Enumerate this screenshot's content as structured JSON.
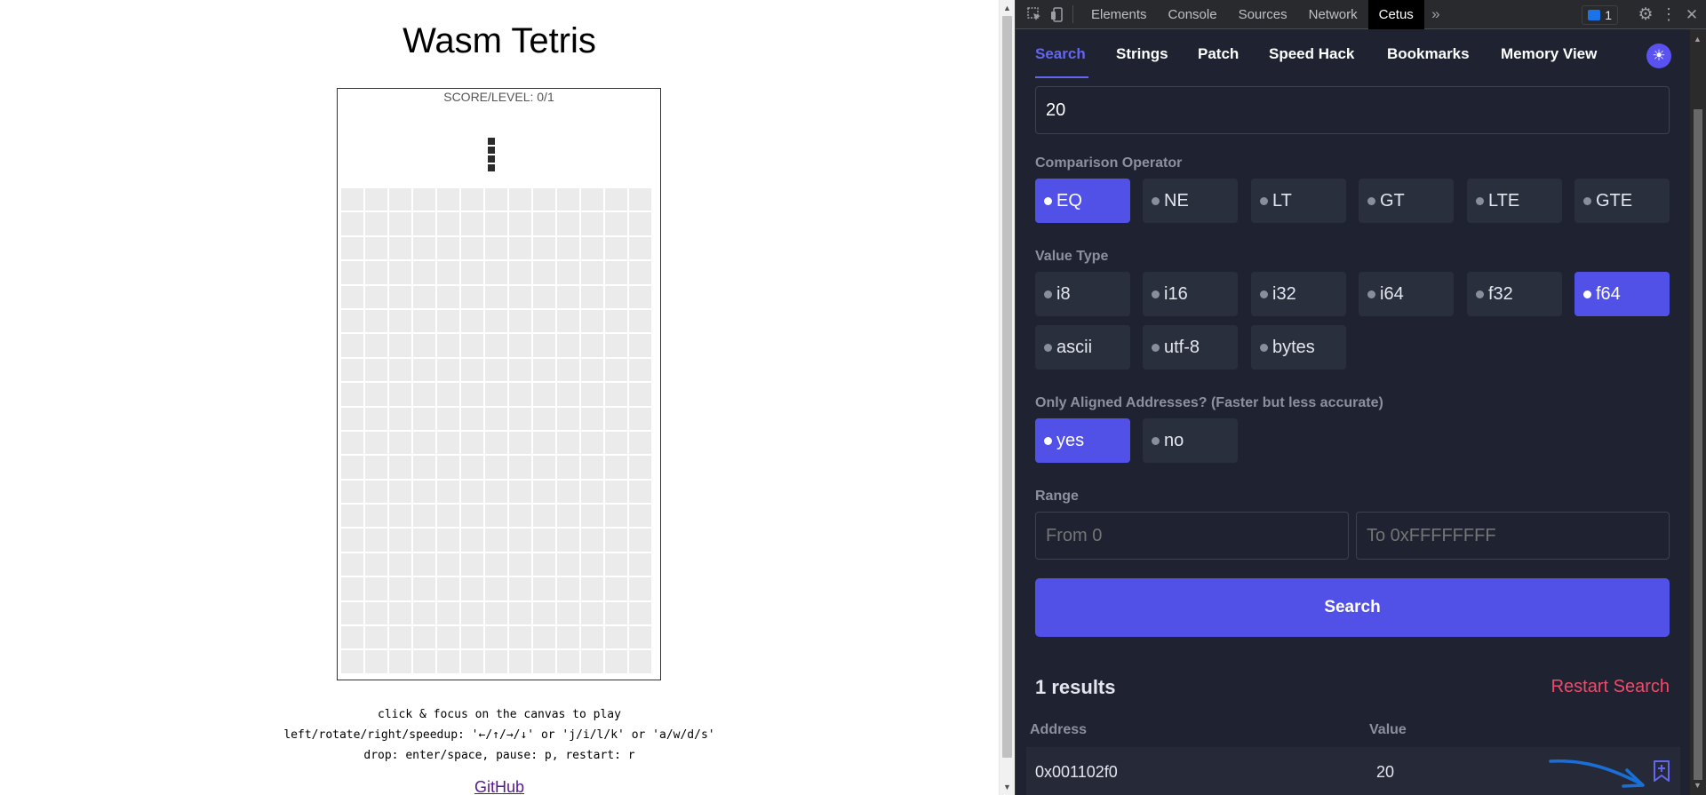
{
  "page": {
    "title": "Wasm Tetris",
    "score_label": "SCORE/LEVEL: 0/1",
    "help_lines": [
      "click & focus on the canvas to play",
      "left/rotate/right/speedup: '←/↑/→/↓' or 'j/i/l/k' or 'a/w/d/s'",
      "drop: enter/space, pause: p, restart: r"
    ],
    "github_link": "GitHub"
  },
  "devtools": {
    "tabs": [
      "Elements",
      "Console",
      "Sources",
      "Network",
      "Cetus"
    ],
    "active_tab": "Cetus",
    "issues_count": "1"
  },
  "cetus": {
    "nav": [
      "Search",
      "Strings",
      "Patch",
      "Speed Hack",
      "Bookmarks",
      "Memory View"
    ],
    "active_nav": "Search",
    "search_value": "20",
    "comparison": {
      "label": "Comparison Operator",
      "options": [
        "EQ",
        "NE",
        "LT",
        "GT",
        "LTE",
        "GTE"
      ],
      "selected": "EQ"
    },
    "value_type": {
      "label": "Value Type",
      "options": [
        "i8",
        "i16",
        "i32",
        "i64",
        "f32",
        "f64",
        "ascii",
        "utf-8",
        "bytes"
      ],
      "selected": "f64"
    },
    "aligned": {
      "label": "Only Aligned Addresses? (Faster but less accurate)",
      "options": [
        "yes",
        "no"
      ],
      "selected": "yes"
    },
    "range": {
      "label": "Range",
      "from_placeholder": "From 0",
      "to_placeholder": "To 0xFFFFFFFF"
    },
    "search_button": "Search",
    "results_count": "1 results",
    "restart_label": "Restart Search",
    "columns": [
      "Address",
      "Value"
    ],
    "results": [
      {
        "address": "0x001102f0",
        "value": "20"
      }
    ]
  },
  "colors": {
    "accent": "#5151e8",
    "restart": "#f04a6a",
    "panel_bg": "#1f2230"
  }
}
